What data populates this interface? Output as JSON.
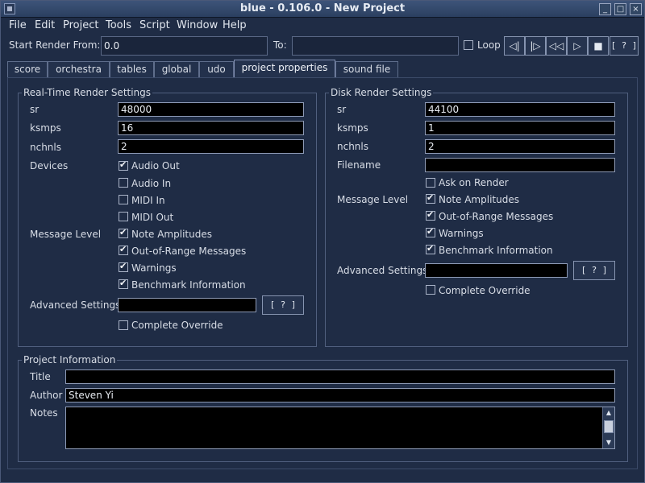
{
  "window": {
    "title": "blue - 0.106.0 - New Project",
    "minimize": "_",
    "maximize": "□",
    "close": "×"
  },
  "menu": [
    "File",
    "Edit",
    "Project",
    "Tools",
    "Script",
    "Window",
    "Help"
  ],
  "toolbar": {
    "start_label": "Start Render From:",
    "start_value": "0.0",
    "to_label": "To:",
    "to_value": "",
    "loop_label": "Loop",
    "loop_checked": false,
    "buttons": [
      "◁|",
      "|▷",
      "◁◁",
      "▷",
      "■",
      "[ ? ]"
    ]
  },
  "tabs": [
    "score",
    "orchestra",
    "tables",
    "global",
    "udo",
    "project properties",
    "sound file"
  ],
  "active_tab": "project properties",
  "realtime": {
    "title": "Real-Time Render Settings",
    "sr_label": "sr",
    "sr": "48000",
    "ksmps_label": "ksmps",
    "ksmps": "16",
    "nchnls_label": "nchnls",
    "nchnls": "2",
    "devices_label": "Devices",
    "devices": [
      {
        "label": "Audio Out",
        "checked": true
      },
      {
        "label": "Audio In",
        "checked": false
      },
      {
        "label": "MIDI In",
        "checked": false
      },
      {
        "label": "MIDI Out",
        "checked": false
      }
    ],
    "message_level_label": "Message Level",
    "messages": [
      {
        "label": "Note Amplitudes",
        "checked": true
      },
      {
        "label": "Out-of-Range Messages",
        "checked": true
      },
      {
        "label": "Warnings",
        "checked": true
      },
      {
        "label": "Benchmark Information",
        "checked": true
      }
    ],
    "advanced_label": "Advanced Settings",
    "advanced_value": "",
    "help_button": "[ ? ]",
    "override_label": "Complete Override",
    "override_checked": false
  },
  "disk": {
    "title": "Disk Render Settings",
    "sr_label": "sr",
    "sr": "44100",
    "ksmps_label": "ksmps",
    "ksmps": "1",
    "nchnls_label": "nchnls",
    "nchnls": "2",
    "filename_label": "Filename",
    "filename": "",
    "ask_label": "Ask on Render",
    "ask_checked": false,
    "message_level_label": "Message Level",
    "messages": [
      {
        "label": "Note Amplitudes",
        "checked": true
      },
      {
        "label": "Out-of-Range Messages",
        "checked": true
      },
      {
        "label": "Warnings",
        "checked": true
      },
      {
        "label": "Benchmark Information",
        "checked": true
      }
    ],
    "advanced_label": "Advanced Settings",
    "advanced_value": "",
    "help_button": "[ ? ]",
    "override_label": "Complete Override",
    "override_checked": false
  },
  "project": {
    "title": "Project Information",
    "title_label": "Title",
    "title_value": "",
    "author_label": "Author",
    "author_value": "Steven Yi",
    "notes_label": "Notes",
    "notes_value": ""
  }
}
